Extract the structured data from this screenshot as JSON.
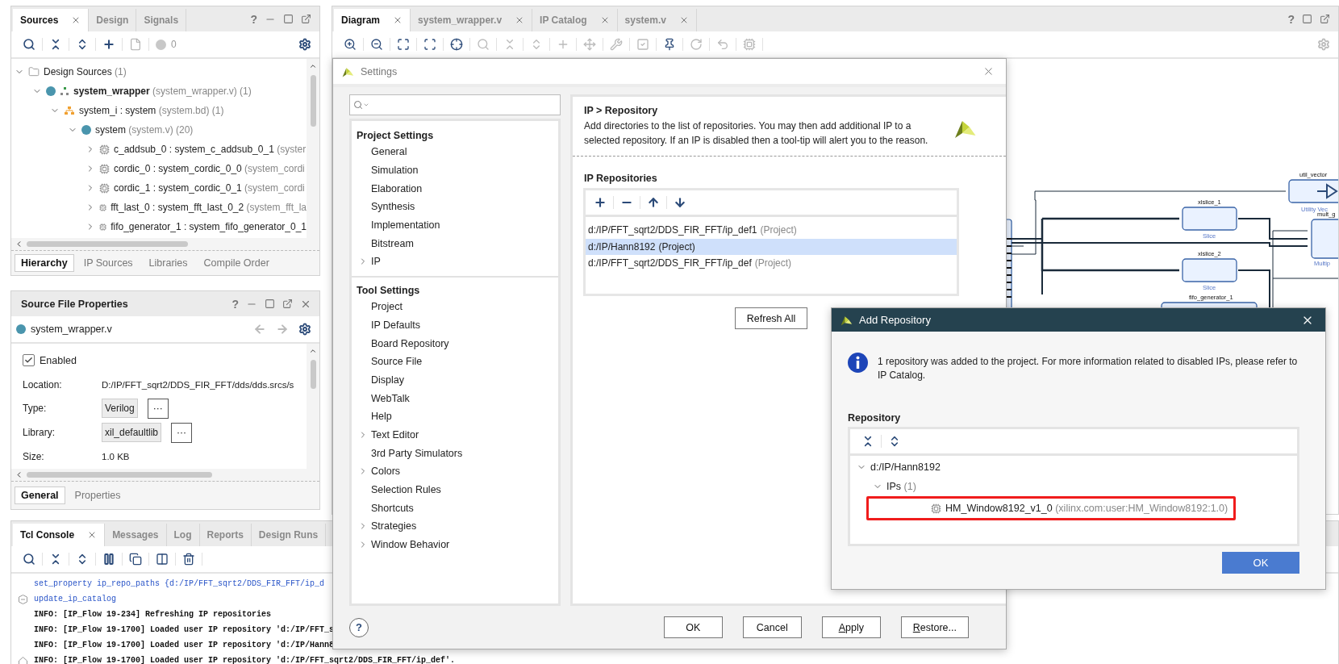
{
  "sources_panel": {
    "tabs": [
      {
        "label": "Sources",
        "selected": true,
        "closable": true
      },
      {
        "label": "Design",
        "selected": false,
        "closable": false
      },
      {
        "label": "Signals",
        "selected": false,
        "closable": false
      }
    ],
    "help": "?",
    "count": "0",
    "tree": [
      {
        "kind": "folder",
        "label": "Design Sources",
        "detail": "(1)",
        "expanded": true,
        "children": [
          {
            "kind": "top",
            "label": "system_wrapper",
            "detail": "(system_wrapper.v) (1)",
            "expanded": true,
            "children": [
              {
                "kind": "bd",
                "label": "system_i : system",
                "detail": "(system.bd) (1)",
                "expanded": true,
                "children": [
                  {
                    "kind": "module",
                    "label": "system",
                    "detail": "(system.v) (20)",
                    "expanded": true,
                    "children": [
                      {
                        "kind": "ip",
                        "label": "c_addsub_0 : system_c_addsub_0_1",
                        "detail": "(syster",
                        "expanded": false
                      },
                      {
                        "kind": "ip",
                        "label": "cordic_0 : system_cordic_0_0",
                        "detail": "(system_cordi",
                        "expanded": false
                      },
                      {
                        "kind": "ip",
                        "label": "cordic_1 : system_cordic_0_1",
                        "detail": "(system_cordi",
                        "expanded": false
                      },
                      {
                        "kind": "ip",
                        "label": "fft_last_0 : system_fft_last_0_2",
                        "detail": "(system_fft_la",
                        "expanded": false
                      },
                      {
                        "kind": "ip",
                        "label": "fifo_generator_1 : system_fifo_generator_0_1",
                        "expanded": false
                      }
                    ]
                  }
                ]
              }
            ]
          }
        ]
      }
    ],
    "bottom_tabs": [
      {
        "label": "Hierarchy",
        "selected": true
      },
      {
        "label": "IP Sources",
        "selected": false
      },
      {
        "label": "Libraries",
        "selected": false
      },
      {
        "label": "Compile Order",
        "selected": false
      }
    ]
  },
  "properties_panel": {
    "title": "Source File Properties",
    "help": "?",
    "file": "system_wrapper.v",
    "enabled": {
      "label": "Enabled",
      "checked": true
    },
    "fields": [
      {
        "kind": "text",
        "label": "Location:",
        "value": "D:/IP/FFT_sqrt2/DDS_FIR_FFT/dds/dds.srcs/s"
      },
      {
        "kind": "select",
        "label": "Type:",
        "value": "Verilog",
        "button": "···"
      },
      {
        "kind": "select",
        "label": "Library:",
        "value": "xil_defaultlib",
        "button": "···"
      },
      {
        "kind": "text",
        "label": "Size:",
        "value": "1.0 KB"
      }
    ],
    "tabs": [
      {
        "label": "General",
        "selected": true
      },
      {
        "label": "Properties",
        "selected": false
      }
    ]
  },
  "diagram_panel": {
    "tabs": [
      {
        "label": "Diagram",
        "selected": true
      },
      {
        "label": "system_wrapper.v",
        "selected": false
      },
      {
        "label": "IP Catalog",
        "selected": false
      },
      {
        "label": "system.v",
        "selected": false
      }
    ],
    "help": "?",
    "blocks": [
      {
        "name": "util_vector",
        "type": "Utility Vec",
        "kind": "inverter"
      },
      {
        "name": "xlslice_1",
        "type": "Slice",
        "kind": "plain"
      },
      {
        "name": "mult_g",
        "type": "Multip",
        "kind": "plain"
      },
      {
        "name": "xlslice_2",
        "type": "Slice",
        "kind": "plain"
      },
      {
        "name": "fifo_generator_1",
        "kind": "plain"
      }
    ]
  },
  "tcl_console": {
    "tabs": [
      {
        "label": "Tcl Console",
        "selected": true,
        "closable": true
      },
      {
        "label": "Messages",
        "selected": false,
        "closable": false
      },
      {
        "label": "Log",
        "selected": false,
        "closable": false
      },
      {
        "label": "Reports",
        "selected": false,
        "closable": false
      },
      {
        "label": "Design Runs",
        "selected": false,
        "closable": false
      }
    ],
    "lines": [
      {
        "kind": "command",
        "text": "set_property ip_repo_paths {d:/IP/FFT_sqrt2/DDS_FIR_FFT/ip_d"
      },
      {
        "kind": "command",
        "fold_open": true,
        "text": "update_ip_catalog"
      },
      {
        "kind": "info",
        "text": "INFO: [IP_Flow 19-234] Refreshing IP repositories"
      },
      {
        "kind": "info",
        "text": "INFO: [IP_Flow 19-1700] Loaded user IP repository 'd:/IP/FFT_s"
      },
      {
        "kind": "info",
        "text": "INFO: [IP_Flow 19-1700] Loaded user IP repository 'd:/IP/Hann8"
      },
      {
        "kind": "info",
        "fold_close": true,
        "text": "INFO: [IP_Flow 19-1700] Loaded user IP repository 'd:/IP/FFT_sqrt2/DDS_FIR_FFT/ip_def'."
      }
    ]
  },
  "settings_dialog": {
    "title": "Settings",
    "help": "?",
    "nav": [
      {
        "heading": "Project Settings",
        "items": [
          {
            "label": "General",
            "kind": "page"
          },
          {
            "label": "Simulation",
            "kind": "page"
          },
          {
            "label": "Elaboration",
            "kind": "page"
          },
          {
            "label": "Synthesis",
            "kind": "page"
          },
          {
            "label": "Implementation",
            "kind": "page"
          },
          {
            "label": "Bitstream",
            "kind": "page"
          },
          {
            "label": "IP",
            "kind": "group"
          }
        ]
      },
      {
        "heading": "Tool Settings",
        "items": [
          {
            "label": "Project",
            "kind": "page"
          },
          {
            "label": "IP Defaults",
            "kind": "page"
          },
          {
            "label": "Board Repository",
            "kind": "page"
          },
          {
            "label": "Source File",
            "kind": "page"
          },
          {
            "label": "Display",
            "kind": "page"
          },
          {
            "label": "WebTalk",
            "kind": "page"
          },
          {
            "label": "Help",
            "kind": "page"
          },
          {
            "label": "Text Editor",
            "kind": "group"
          },
          {
            "label": "3rd Party Simulators",
            "kind": "page"
          },
          {
            "label": "Colors",
            "kind": "group"
          },
          {
            "label": "Selection Rules",
            "kind": "page"
          },
          {
            "label": "Shortcuts",
            "kind": "page"
          },
          {
            "label": "Strategies",
            "kind": "group"
          },
          {
            "label": "Window Behavior",
            "kind": "group"
          }
        ]
      }
    ],
    "page_title": "IP > Repository",
    "description": "Add directories to the list of repositories. You may then add additional IP to a selected repository. If an IP is disabled then a tool-tip will alert you to the reason.",
    "list_title": "IP Repositories",
    "repositories": [
      {
        "path": "d:/IP/FFT_sqrt2/DDS_FIR_FFT/ip_def1",
        "tag": "(Project)",
        "selected": false
      },
      {
        "path": "d:/IP/Hann8192",
        "tag": "(Project)",
        "selected": true
      },
      {
        "path": "d:/IP/FFT_sqrt2/DDS_FIR_FFT/ip_def",
        "tag": "(Project)",
        "selected": false
      }
    ],
    "refresh": "Refresh All",
    "buttons": [
      {
        "label": "OK",
        "mnemonic": false
      },
      {
        "label": "Cancel",
        "mnemonic": false
      },
      {
        "label": "Apply",
        "mnemonic": true
      },
      {
        "label": "Restore...",
        "mnemonic": true
      }
    ]
  },
  "add_repository_dialog": {
    "title": "Add Repository",
    "message": "1 repository was added to the project. For more information related to disabled IPs, please refer to IP Catalog.",
    "heading": "Repository",
    "tree": [
      {
        "label": "d:/IP/Hann8192",
        "expanded": true,
        "children": [
          {
            "label": "IPs",
            "detail": "(1)",
            "expanded": true,
            "children": [
              {
                "kind": "ip",
                "label": "HM_Window8192_v1_0",
                "detail": "(xilinx.com:user:HM_Window8192:1.0)",
                "highlighted": true
              }
            ]
          }
        ]
      }
    ],
    "ok": "OK"
  }
}
